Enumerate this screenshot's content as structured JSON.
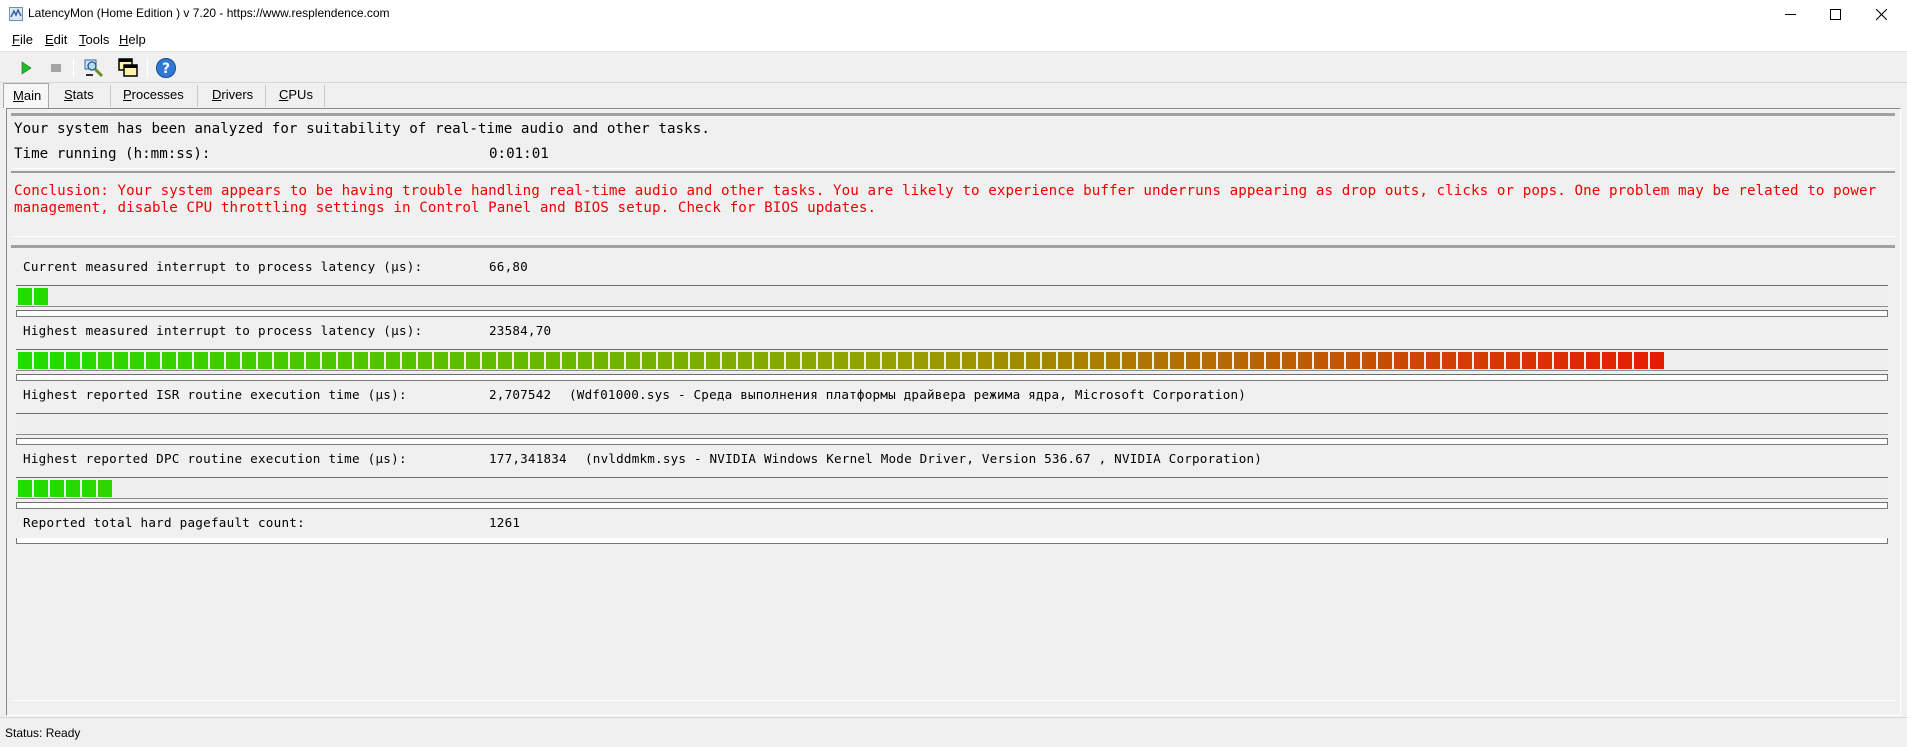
{
  "window": {
    "title": "LatencyMon  (Home Edition )  v 7.20 - https://www.resplendence.com"
  },
  "menu": [
    "File",
    "Edit",
    "Tools",
    "Help"
  ],
  "toolbar": {
    "icons": [
      "play-icon",
      "stop-icon",
      "analyze-icon",
      "windows-icon",
      "help-icon"
    ]
  },
  "tabs": [
    "Main",
    "Stats",
    "Processes",
    "Drivers",
    "CPUs"
  ],
  "active_tab": "Main",
  "summary": {
    "analyzed_text": "Your system has been analyzed for suitability of real-time audio and other tasks.",
    "time_running_label": "Time running (h:mm:ss):",
    "time_running_value": "0:01:01"
  },
  "conclusion": "Conclusion: Your system appears to be having trouble handling real-time audio and other tasks. You are likely to experience buffer underruns appearing as drop outs, clicks or pops. One problem may be related to power management, disable CPU throttling settings in Control Panel and BIOS setup. Check for BIOS updates.",
  "meters": [
    {
      "label": "Current measured interrupt to process latency (µs):",
      "value": "66,80",
      "detail": "",
      "fill_fraction": 0.016
    },
    {
      "label": "Highest measured interrupt to process latency (µs):",
      "value": "23584,70",
      "detail": "",
      "fill_fraction": 0.94
    },
    {
      "label": "Highest reported ISR routine execution time (µs):",
      "value": "2,707542",
      "detail": "(Wdf01000.sys - Среда выполнения платформы драйвера режима ядра, Microsoft Corporation)",
      "fill_fraction": 0.0
    },
    {
      "label": "Highest reported DPC routine execution time (µs):",
      "value": "177,341834",
      "detail": "(nvlddmkm.sys - NVIDIA Windows Kernel Mode Driver, Version 536.67 , NVIDIA Corporation)",
      "fill_fraction": 0.05
    }
  ],
  "pagefault": {
    "label": "Reported total hard pagefault count:",
    "value": "1261"
  },
  "status": "Status: Ready"
}
